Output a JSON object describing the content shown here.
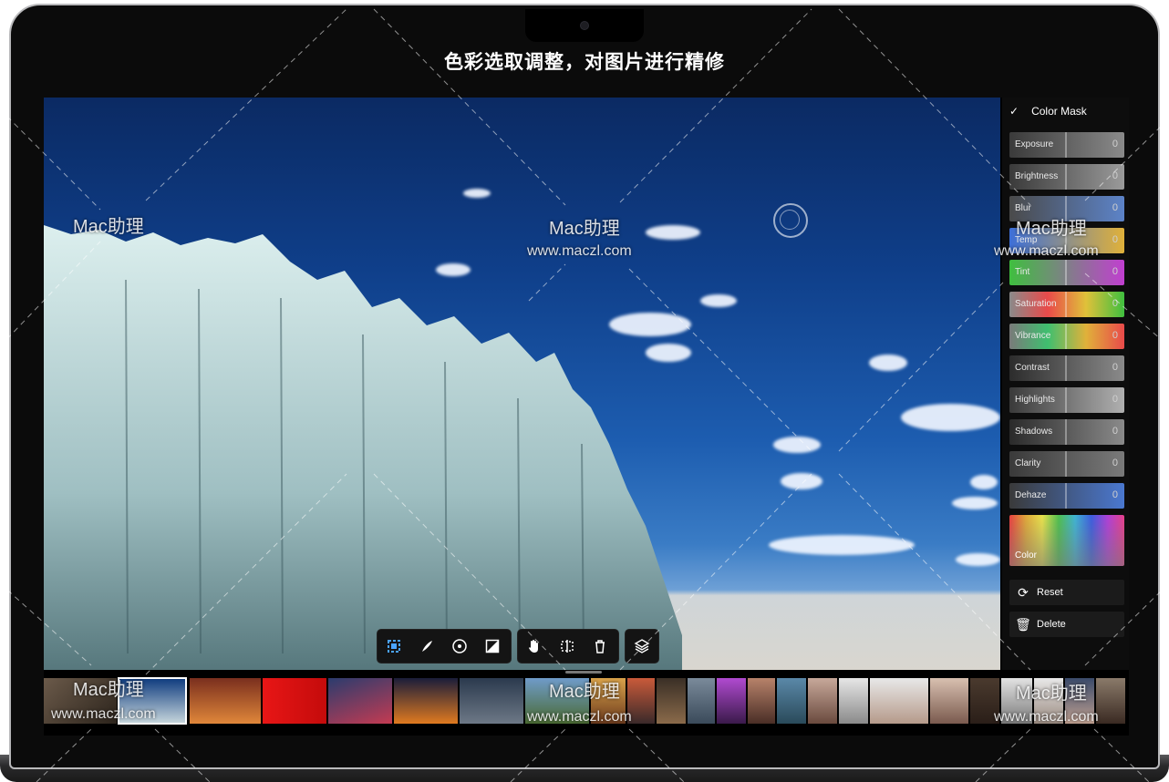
{
  "caption": "色彩选取调整，对图片进行精修",
  "panel": {
    "title": "Color Mask",
    "check_icon": "check-icon",
    "sliders": [
      {
        "label": "Exposure",
        "value": "0"
      },
      {
        "label": "Brightness",
        "value": "0"
      },
      {
        "label": "Blur",
        "value": "0"
      },
      {
        "label": "Temp",
        "value": "0"
      },
      {
        "label": "Tint",
        "value": "0"
      },
      {
        "label": "Saturation",
        "value": "0"
      },
      {
        "label": "Vibrance",
        "value": "0"
      },
      {
        "label": "Contrast",
        "value": "0"
      },
      {
        "label": "Highlights",
        "value": "0"
      },
      {
        "label": "Shadows",
        "value": "0"
      },
      {
        "label": "Clarity",
        "value": "0"
      },
      {
        "label": "Dehaze",
        "value": "0"
      }
    ],
    "color_label": "Color",
    "reset_label": "Reset",
    "delete_label": "Delete"
  },
  "toolbar": {
    "tools": [
      "select-icon",
      "brush-icon",
      "radial-icon",
      "gradient-icon"
    ],
    "actions": [
      "hand-icon",
      "split-icon",
      "trash-icon"
    ],
    "layers": "layers-icon"
  },
  "watermarks": {
    "brand": "Mac助理",
    "url": "www.maczl.com"
  },
  "colors": {
    "accent": "#4aa3ff",
    "panel_bg": "#0d0d0d"
  }
}
